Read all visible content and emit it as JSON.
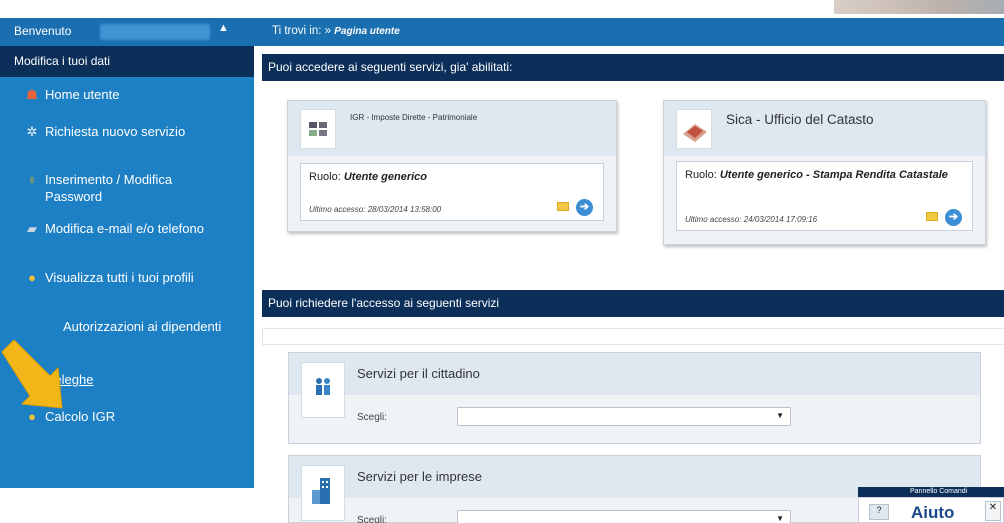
{
  "header": {
    "welcome_label": "Benvenuto",
    "breadcrumb_prefix": "Ti trovi in:",
    "breadcrumb_separator": "»",
    "breadcrumb_current": "Pagina utente"
  },
  "sidebar": {
    "title": "Modifica i tuoi dati",
    "items": [
      {
        "label": "Home utente",
        "icon": "home-icon"
      },
      {
        "label": "Richiesta nuovo servizio",
        "icon": "gear-icon"
      },
      {
        "label": "Inserimento / Modifica Password",
        "icon": "key-icon"
      },
      {
        "label": "Modifica e-mail e/o telefono",
        "icon": "car-icon"
      },
      {
        "label": "Visualizza tutti i tuoi profili",
        "icon": "person-icon"
      },
      {
        "label": "Autorizzazioni ai dipendenti",
        "icon": "arrow-overlay"
      },
      {
        "label": "Deleghe",
        "icon": "document-icon"
      },
      {
        "label": "Calcolo IGR",
        "icon": "person-icon"
      }
    ]
  },
  "enabled_services": {
    "heading": "Puoi accedere ai seguenti servizi, gia' abilitati:",
    "role_label": "Ruolo:",
    "last_access_label": "Ultimo accesso:",
    "cards": [
      {
        "title": "IGR - Imposte Dirette - Patrimoniale",
        "role": "Utente generico",
        "last_access": "28/03/2014 13:58:00"
      },
      {
        "title": "Sica - Ufficio del Catasto",
        "role": "Utente generico - Stampa Rendita Catastale",
        "last_access": "24/03/2014 17:09:16"
      }
    ]
  },
  "request_services": {
    "heading": "Puoi richiedere l'accesso ai seguenti servizi",
    "choose_label": "Scegli:",
    "panels": [
      {
        "title": "Servizi per il cittadino",
        "icon": "citizen-icon"
      },
      {
        "title": "Servizi per le imprese",
        "icon": "building-icon"
      }
    ]
  },
  "help_widget": {
    "bar_label": "Pannello Comandi",
    "label": "Aiuto"
  },
  "colors": {
    "sidebar": "#1d7fc4",
    "dark_bar": "#0c2f5a",
    "card_header": "#dfe8f1",
    "arrow": "#f2b619"
  }
}
